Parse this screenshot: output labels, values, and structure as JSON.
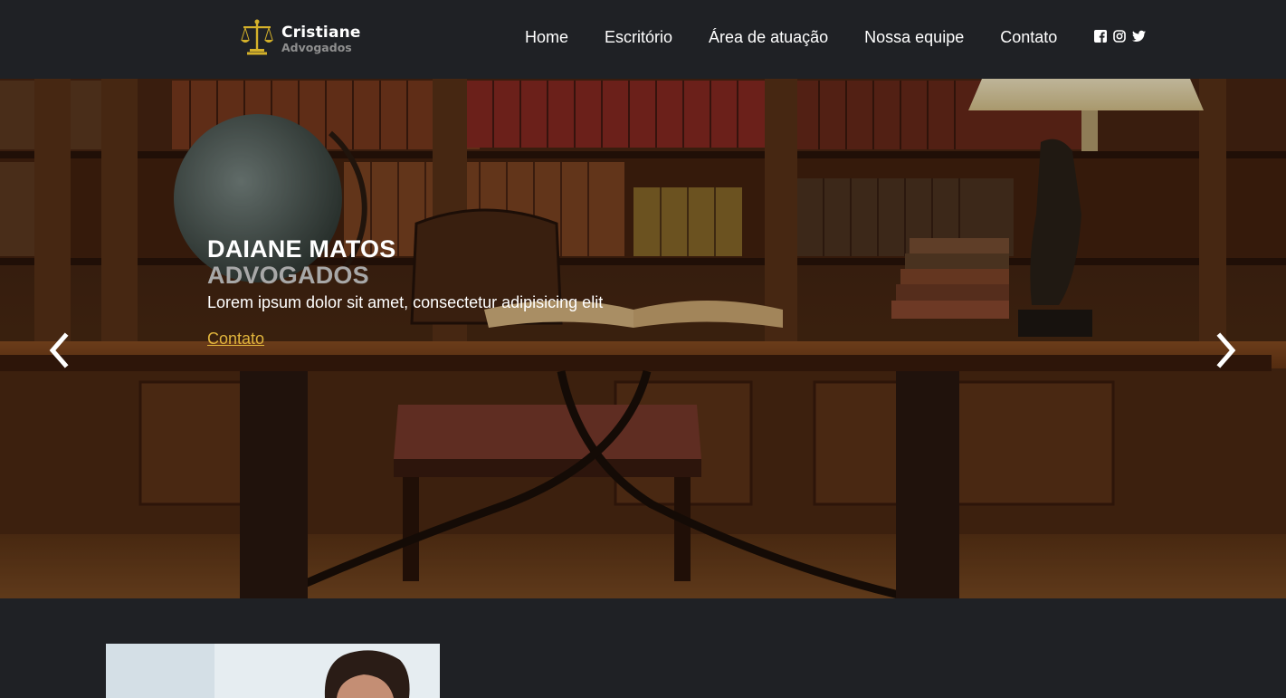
{
  "brand": {
    "name": "Cristiane",
    "subtitle": "Advogados",
    "icon": "scales-of-justice-icon",
    "accent_color": "#d4b12a"
  },
  "nav": {
    "items": [
      "Home",
      "Escritório",
      "Área de atuação",
      "Nossa equipe",
      "Contato"
    ]
  },
  "social": [
    "facebook-icon",
    "instagram-icon",
    "twitter-icon"
  ],
  "hero": {
    "title": "DAIANE MATOS",
    "subtitle": "ADVOGADOS",
    "text": "Lorem ipsum dolor sit amet, consectetur adipisicing elit",
    "link_label": "Contato",
    "link_color": "#e0b43c",
    "prev_icon": "chevron-left-icon",
    "next_icon": "chevron-right-icon"
  },
  "colors": {
    "background": "#1f2125"
  }
}
